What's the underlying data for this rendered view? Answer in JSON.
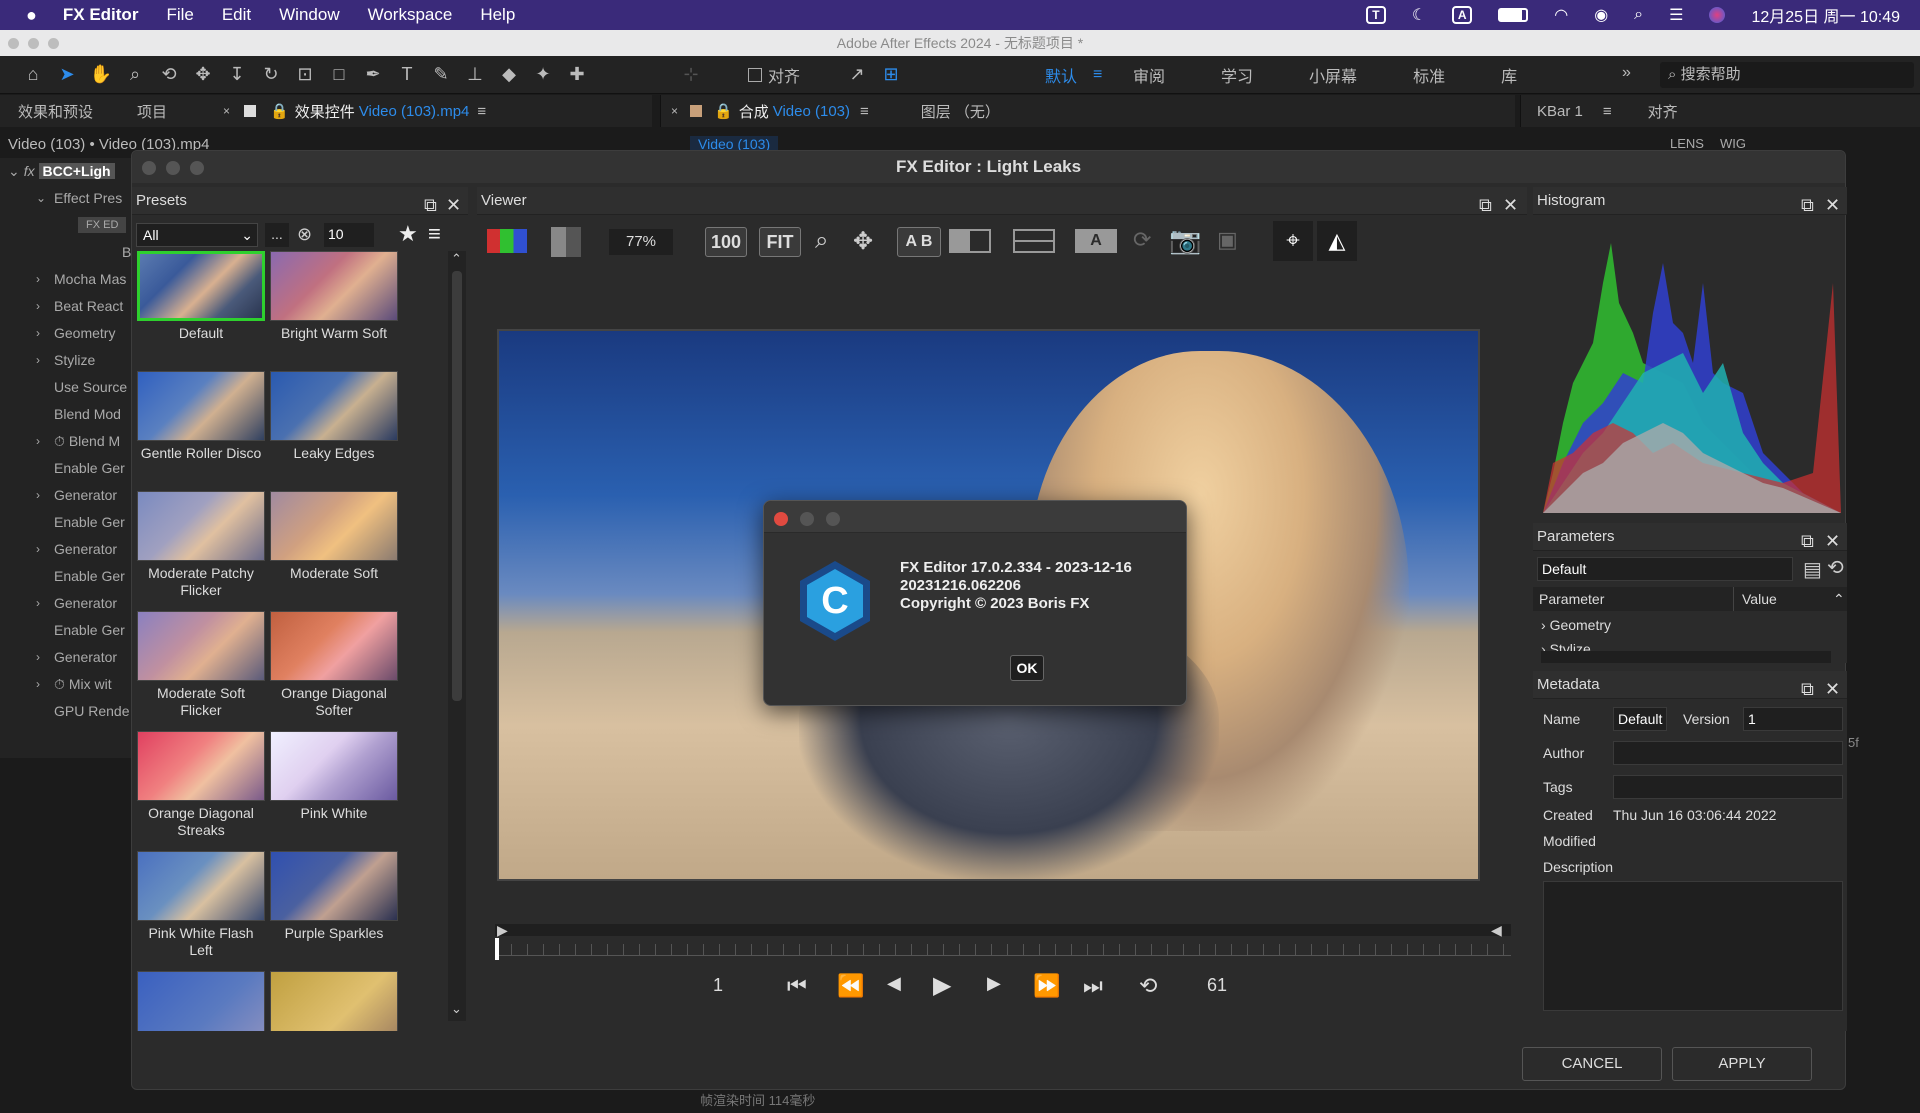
{
  "menubar": {
    "apple": "",
    "app": "FX Editor",
    "items": [
      "File",
      "Edit",
      "Window",
      "Workspace",
      "Help"
    ],
    "status_t": "T",
    "status_a": "A",
    "clock": "12月25日 周一 10:49"
  },
  "ae": {
    "title": "Adobe After Effects 2024 - 无标题项目 *",
    "snap": "对齐",
    "workspaces": [
      "默认",
      "审阅",
      "学习",
      "小屏幕",
      "标准",
      "库"
    ],
    "search": "搜索帮助",
    "more": "»",
    "panels": {
      "effects": "效果和预设",
      "project": "项目",
      "effect_controls": "效果控件",
      "effect_controls_file": "Video (103).mp4",
      "comp": "合成",
      "comp_name": "Video (103)",
      "layer": "图层 （无）",
      "kbar": "KBar 1",
      "align": "对齐",
      "comp_tab": "Video (103)",
      "lens": "LENS",
      "wig": "WIG"
    },
    "breadcrumb": "Video (103) • Video (103).mp4",
    "fx_label": "fx",
    "effect_name": "BCC+Ligh",
    "fx_ed": "FX ED",
    "b_label": "B",
    "tree": [
      "Effect Pres",
      "Mocha Mas",
      "Beat React",
      "Geometry",
      "Stylize",
      "Use Source",
      "Blend Mod",
      "Blend M",
      "Enable Ger",
      "Generator",
      "Enable Ger",
      "Generator",
      "Enable Ger",
      "Generator",
      "Enable Ger",
      "Generator",
      "Mix wit",
      "GPU Rende"
    ],
    "bottom_status": "帧渲染时间  114毫秒",
    "timecode_right": "5f"
  },
  "fx": {
    "title": "FX Editor : Light Leaks",
    "presets": {
      "title": "Presets",
      "filter": "All",
      "ellipsis": "...",
      "size": "10",
      "items": [
        "Default",
        "Bright Warm Soft",
        "Gentle Roller Disco",
        "Leaky Edges",
        "Moderate Patchy Flicker",
        "Moderate Soft",
        "Moderate Soft Flicker",
        "Orange Diagonal Softer",
        "Orange Diagonal Streaks",
        "Pink White",
        "Pink White Flash Left",
        "Purple Sparkles"
      ]
    },
    "viewer": {
      "title": "Viewer",
      "zoom": "77%",
      "btn100": "100",
      "fit": "FIT",
      "ab": "A B",
      "frame_start": "1",
      "frame_end": "61"
    },
    "histogram": {
      "title": "Histogram"
    },
    "parameters": {
      "title": "Parameters",
      "preset": "Default",
      "col_param": "Parameter",
      "col_value": "Value",
      "rows": [
        "Geometry",
        "Stylize"
      ]
    },
    "metadata": {
      "title": "Metadata",
      "name_label": "Name",
      "name": "Default",
      "version_label": "Version",
      "version": "1",
      "author_label": "Author",
      "author": "",
      "tags_label": "Tags",
      "tags": "",
      "created_label": "Created",
      "created": "Thu Jun 16 03:06:44 2022",
      "modified_label": "Modified",
      "modified": "",
      "description_label": "Description",
      "description": ""
    },
    "cancel": "CANCEL",
    "apply": "APPLY"
  },
  "about": {
    "line1": "FX Editor 17.0.2.334 - 2023-12-16",
    "line2": "20231216.062206",
    "line3": "Copyright © 2023 Boris FX",
    "logo": "C",
    "ok": "OK"
  },
  "colors": {
    "accent": "#2ed02e",
    "menubar": "#3a2a7a",
    "ae_blue": "#2d8ceb"
  }
}
